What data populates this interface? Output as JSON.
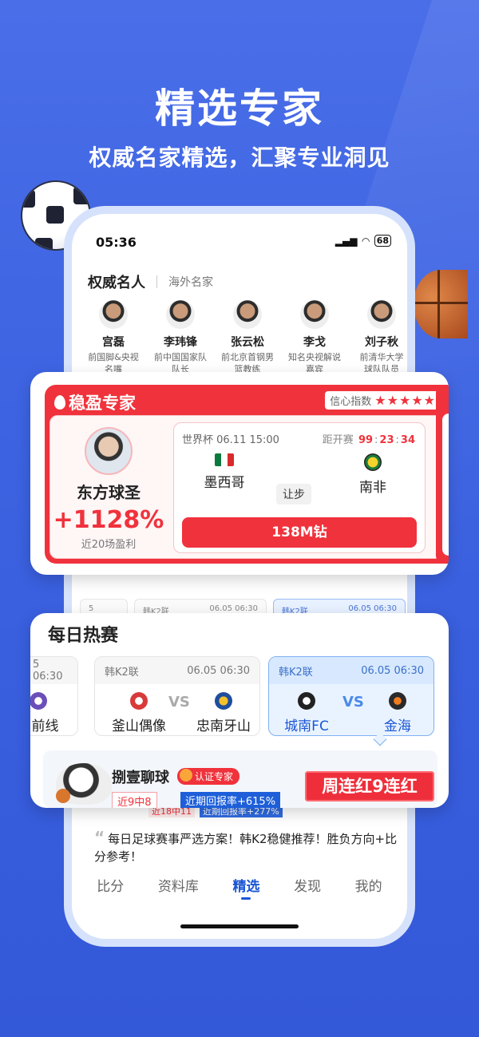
{
  "hero": {
    "title": "精选专家",
    "subtitle": "权威名家精选，汇聚专业洞见"
  },
  "status": {
    "time": "05:36",
    "battery": "68"
  },
  "section": {
    "active_tab": "权威名人",
    "other_tab": "海外名家"
  },
  "experts": [
    {
      "name": "宫磊",
      "desc1": "前国脚&央视",
      "desc2": "名嘴"
    },
    {
      "name": "李玮锋",
      "desc1": "前中国国家队",
      "desc2": "队长"
    },
    {
      "name": "张云松",
      "desc1": "前北京首钢男",
      "desc2": "篮教练"
    },
    {
      "name": "李戈",
      "desc1": "知名央视解说",
      "desc2": "嘉宾"
    },
    {
      "name": "刘子秋",
      "desc1": "前清华大学",
      "desc2": "球队队员"
    }
  ],
  "card1": {
    "title": "稳盈专家",
    "confidence_label": "信心指数",
    "stars": "★★★★★",
    "author": {
      "name": "东方球圣",
      "profit": "+1128%",
      "note": "近20场盈利"
    },
    "match": {
      "league_time": "世界杯  06.11 15:00",
      "countdown_label": "距开赛",
      "cd_h": "99",
      "cd_m": "23",
      "cd_s": "34",
      "home": "墨西哥",
      "away": "南非",
      "handicap": "让步",
      "price": "138M钻"
    }
  },
  "phone_bg": {
    "hot_title": "每日热赛",
    "mini": [
      {
        "l": "",
        "t": "5 06:30"
      },
      {
        "l": "韩K2联",
        "t": "06.05 06:30"
      },
      {
        "l": "韩K2联",
        "t": "06.05 06:30"
      }
    ],
    "chip1": "近18中11",
    "chip2": "近期回报率+277%",
    "quote": "每日足球赛事严选方案！韩K2稳健推荐！胜负方向+比分参考！",
    "tabs": [
      "比分",
      "资料库",
      "精选",
      "发现",
      "我的"
    ]
  },
  "card2": {
    "title": "每日热赛",
    "games": [
      {
        "league": "",
        "time": "5 06:30",
        "home": "",
        "away": "州前线"
      },
      {
        "league": "韩K2联",
        "time": "06.05 06:30",
        "home": "釜山偶像",
        "away": "忠南牙山",
        "vs": "VS"
      },
      {
        "league": "韩K2联",
        "time": "06.05 06:30",
        "home": "城南FC",
        "away": "金海",
        "vs": "VS"
      }
    ],
    "rec": {
      "name": "捌壹聊球",
      "badge": "认证专家",
      "chip1": "近9中8",
      "chip2": "近期回报率+615%",
      "streak": "周连红9连红"
    }
  }
}
